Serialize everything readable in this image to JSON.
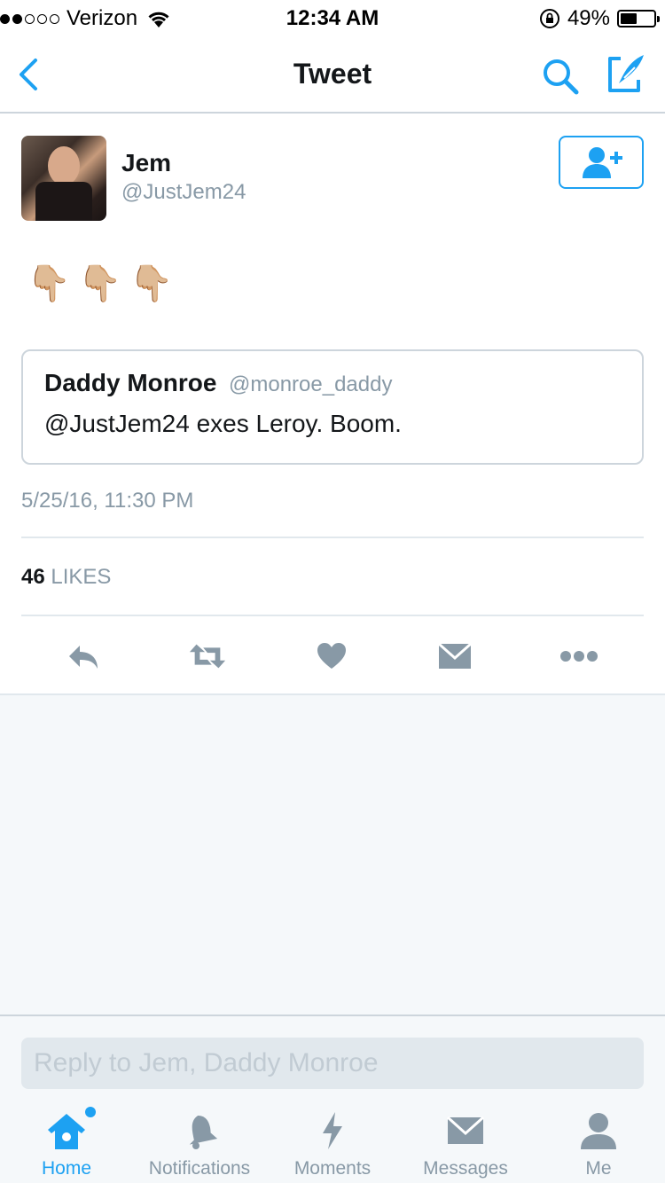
{
  "status_bar": {
    "carrier": "Verizon",
    "time": "12:34 AM",
    "battery": "49%",
    "battery_level": 0.49,
    "signal_bars": 2
  },
  "nav": {
    "title": "Tweet",
    "back_icon": "chevron-left-icon",
    "search_icon": "search-icon",
    "compose_icon": "compose-icon"
  },
  "tweet": {
    "author_name": "Jem",
    "author_handle": "@JustJem24",
    "text": "👇🏼👇🏼👇🏼",
    "quoted": {
      "name": "Daddy Monroe",
      "handle": "@monroe_daddy",
      "text": "@JustJem24 exes Leroy. Boom."
    },
    "timestamp": "5/25/16, 11:30 PM",
    "likes_count": "46",
    "likes_label": "LIKES"
  },
  "reply": {
    "placeholder": "Reply to Jem, Daddy Monroe"
  },
  "tabs": [
    {
      "label": "Home",
      "icon": "home-icon",
      "active": true
    },
    {
      "label": "Notifications",
      "icon": "bell-icon",
      "active": false
    },
    {
      "label": "Moments",
      "icon": "lightning-icon",
      "active": false
    },
    {
      "label": "Messages",
      "icon": "envelope-icon",
      "active": false
    },
    {
      "label": "Me",
      "icon": "person-icon",
      "active": false
    }
  ],
  "colors": {
    "accent": "#1da1f2",
    "muted": "#8899a6",
    "icon_gray": "#8899a6",
    "text": "#14171a"
  }
}
